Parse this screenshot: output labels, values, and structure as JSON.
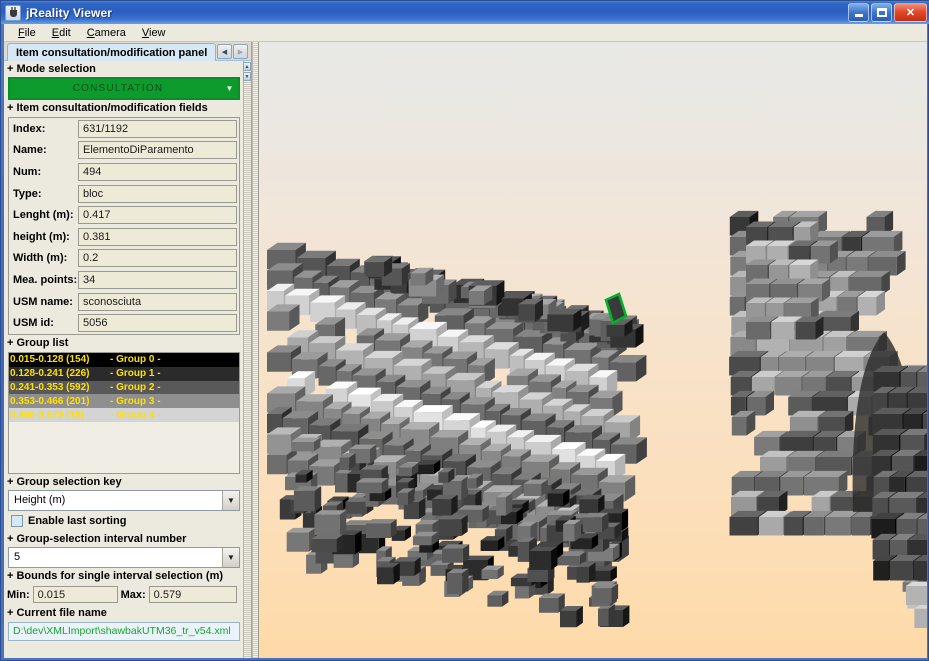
{
  "window": {
    "title": "jReality Viewer",
    "app_icon": "java-coffee-cup-icon",
    "minimize_label": "_",
    "maximize_label": "□",
    "close_label": "✕"
  },
  "menubar": {
    "items": [
      {
        "label": "File",
        "mnemonic": "F"
      },
      {
        "label": "Edit",
        "mnemonic": "E"
      },
      {
        "label": "Camera",
        "mnemonic": "C"
      },
      {
        "label": "View",
        "mnemonic": "V"
      }
    ]
  },
  "tabs": {
    "active": "Item consultation/modification panel",
    "scroll_left_icon": "◀",
    "scroll_right_icon": "▶"
  },
  "panel": {
    "mode_section": {
      "header": "Mode selection",
      "selected": "CONSULTATION",
      "arrow_icon": "▼",
      "accent_color": "#0d9b2e"
    },
    "fields_section": {
      "header": "Item consultation/modification fields",
      "rows": [
        {
          "label": "Index:",
          "value": "631/1192"
        },
        {
          "label": "Name:",
          "value": "ElementoDiParamento"
        },
        {
          "label": "Num:",
          "value": "494"
        },
        {
          "label": "Type:",
          "value": "bloc"
        },
        {
          "label": "Lenght (m):",
          "value": "0.417"
        },
        {
          "label": "height (m):",
          "value": "0.381"
        },
        {
          "label": "Width (m):",
          "value": "0.2"
        },
        {
          "label": "Mea. points:",
          "value": "34"
        },
        {
          "label": "USM name:",
          "value": "sconosciuta"
        },
        {
          "label": "USM id:",
          "value": "5056"
        }
      ]
    },
    "group_section": {
      "header": "Group list",
      "text_color": "#ffe000",
      "rows": [
        {
          "range": "0.015-0.128 (154)",
          "name": "- Group 0 -",
          "bg": "#000000"
        },
        {
          "range": "0.128-0.241 (226)",
          "name": "- Group 1 -",
          "bg": "#2b2b2b"
        },
        {
          "range": "0.241-0.353 (592)",
          "name": "- Group 2 -",
          "bg": "#595959"
        },
        {
          "range": "0.353-0.466 (201)",
          "name": "- Group 3 -",
          "bg": "#8f8f8f"
        },
        {
          "range": "0.466-0.579 (19)",
          "name": "- Group 4 -",
          "bg": "#d4d4d4"
        }
      ]
    },
    "group_key_section": {
      "header": "Group selection key",
      "selected": "Height (m)",
      "arrow_icon": "▼"
    },
    "sorting": {
      "label": "Enable last sorting",
      "checked": false
    },
    "interval_section": {
      "header": "Group-selection interval number",
      "selected": "5",
      "arrow_icon": "▼"
    },
    "bounds_section": {
      "header": "Bounds for single interval selection (m)",
      "min_label": "Min:",
      "min_value": "0.015",
      "max_label": "Max:",
      "max_value": "0.579"
    },
    "file_section": {
      "header": "Current file name",
      "path": "D:\\dev\\XMLImport\\shawbakUTM36_tr_v54.xml",
      "text_color": "#18a42a"
    }
  },
  "viewport": {
    "name": "3d-model-viewport",
    "model": "stone-block-wall-point-cloud",
    "selected_block_color": "#00b22a",
    "background_top": "#e8e8e6",
    "background_bottom": "#fedaa8"
  }
}
